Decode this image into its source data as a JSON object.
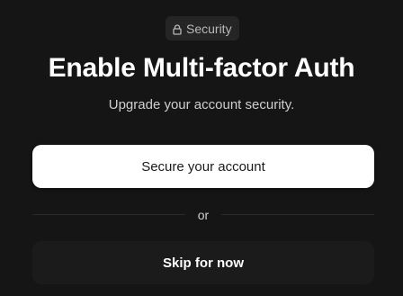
{
  "badge": {
    "icon": "lock-icon",
    "label": "Security"
  },
  "heading": {
    "title": "Enable Multi-factor Auth",
    "subtitle": "Upgrade your account security."
  },
  "actions": {
    "primary_label": "Secure your account",
    "divider_label": "or",
    "secondary_label": "Skip for now"
  },
  "colors": {
    "background": "#151515",
    "primary_button": "#ffffff",
    "secondary_button": "#1b1b1b",
    "badge_background": "#252525"
  }
}
